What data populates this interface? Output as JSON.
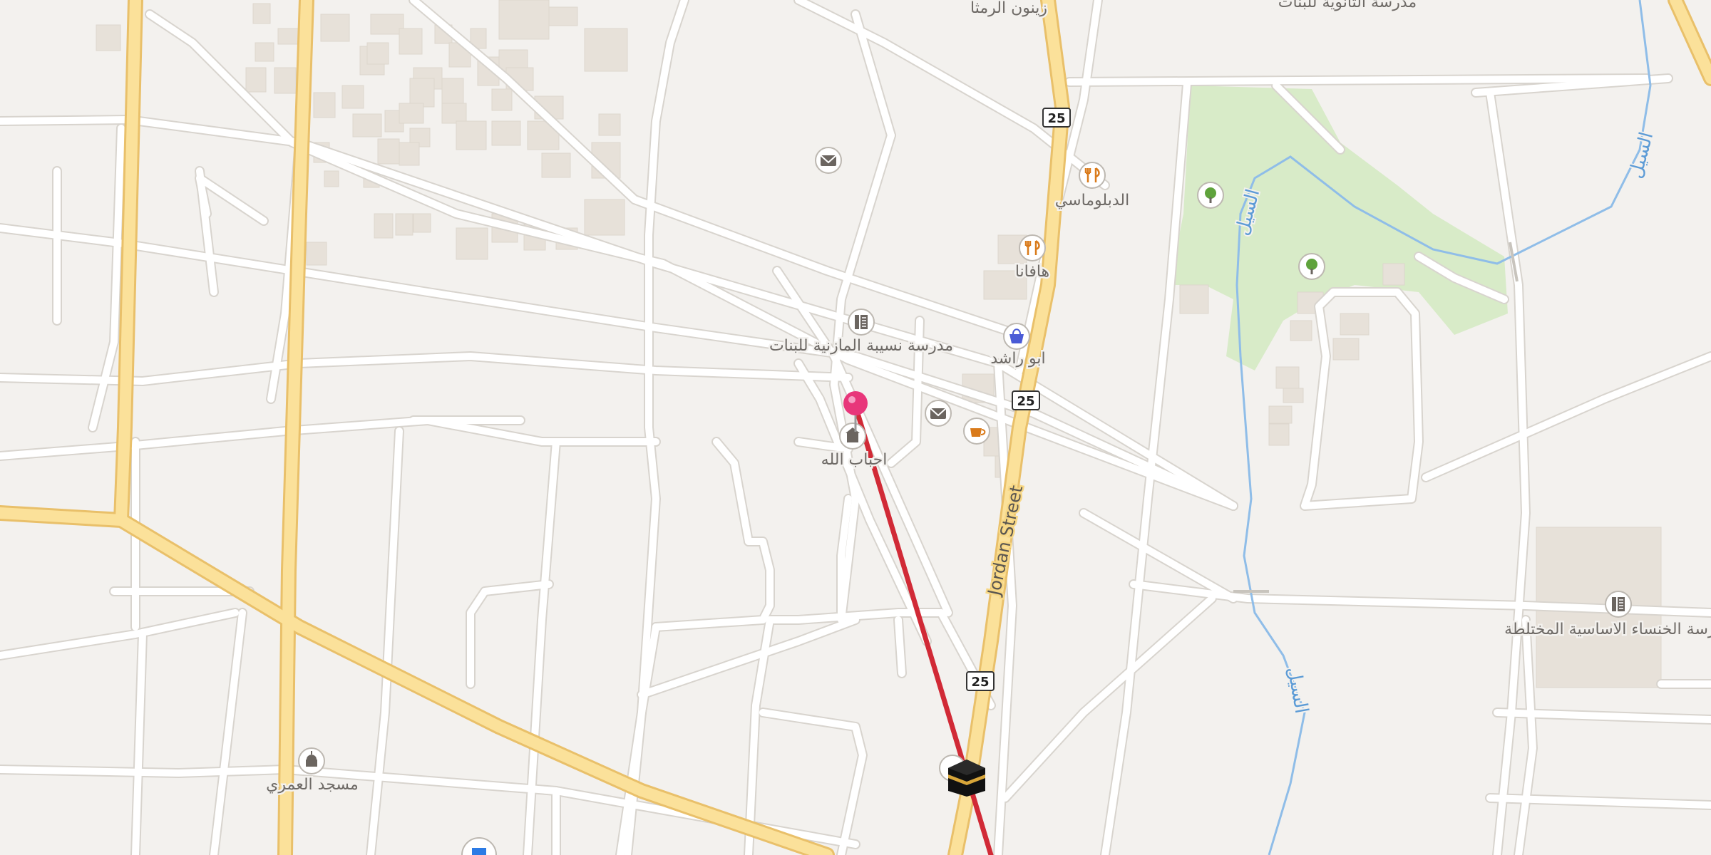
{
  "map": {
    "route_shield": "25",
    "street_name": "Jordan Street",
    "waterway_name": "السيل",
    "colors": {
      "background": "#f3f1ee",
      "minor_road": "#ffffff",
      "road_casing": "#d8d4ce",
      "major_road": "#fbe19a",
      "major_road_casing": "#e9c06a",
      "park": "#d8ebc8",
      "building": "#e7e1d9",
      "water": "#8fbde8",
      "route_line": "#d12a36",
      "pin": "#e8367a"
    }
  },
  "pois": [
    {
      "name": "زينون الرمثا",
      "icon": "none"
    },
    {
      "name": "مدرسة الثانوية للبنات",
      "icon": "none"
    },
    {
      "name": "الدبلوماسي",
      "icon": "restaurant-icon"
    },
    {
      "name": "هافانا",
      "icon": "restaurant-icon"
    },
    {
      "name": "ابو راشد",
      "icon": "shopping-icon"
    },
    {
      "name": "مدرسة نسيبة المازنية للبنات",
      "icon": "school-icon"
    },
    {
      "name": "احباب الله",
      "icon": "kindergarten-icon"
    },
    {
      "name": "مدرسة الخنساء الاساسية المختلطة",
      "icon": "school-icon"
    },
    {
      "name": "مسجد العمري",
      "icon": "mosque-icon"
    }
  ],
  "markers": {
    "pin": "destination-pin-icon",
    "kaaba": "kaaba-icon",
    "post_office_1": "post-office-icon",
    "post_office_2": "post-office-icon",
    "cafe": "cafe-icon",
    "park_tree_1": "tree-icon",
    "park_tree_2": "tree-icon"
  }
}
